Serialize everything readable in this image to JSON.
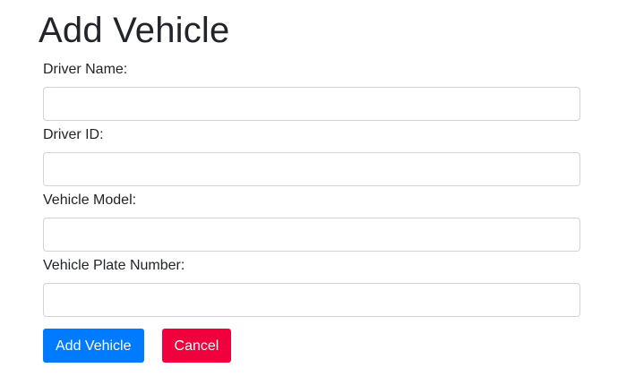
{
  "page": {
    "title": "Add Vehicle"
  },
  "form": {
    "fields": [
      {
        "label": "Driver Name:",
        "value": "",
        "placeholder": ""
      },
      {
        "label": "Driver ID:",
        "value": "",
        "placeholder": ""
      },
      {
        "label": "Vehicle Model:",
        "value": "",
        "placeholder": ""
      },
      {
        "label": "Vehicle Plate Number:",
        "value": "",
        "placeholder": ""
      }
    ]
  },
  "actions": {
    "submit_label": "Add Vehicle",
    "cancel_label": "Cancel"
  },
  "colors": {
    "primary": "#007bff",
    "danger": "#f0003c",
    "input_border": "#ced4da",
    "text": "#212529"
  }
}
